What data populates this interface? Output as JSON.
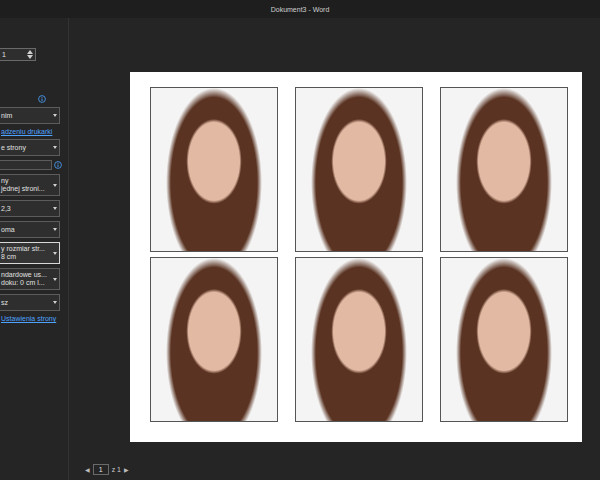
{
  "window": {
    "title": "Dokument3 - Word"
  },
  "left_panel": {
    "items": [
      {
        "kind": "spinner",
        "value": "1"
      },
      {
        "kind": "info"
      },
      {
        "kind": "dropdown",
        "lines": [
          "nim"
        ],
        "focused": false
      },
      {
        "kind": "link",
        "text": "ądzeniu drukarki"
      },
      {
        "kind": "dropdown",
        "lines": [
          "e strony"
        ],
        "focused": false
      },
      {
        "kind": "field",
        "value": ""
      },
      {
        "kind": "dropdown",
        "lines": [
          "ny",
          "jednej stroni..."
        ],
        "focused": false
      },
      {
        "kind": "dropdown",
        "lines": [
          "2,3"
        ],
        "focused": false
      },
      {
        "kind": "dropdown",
        "lines": [
          "oma"
        ],
        "focused": false
      },
      {
        "kind": "dropdown",
        "lines": [
          "y rozmiar str...",
          "8 cm"
        ],
        "focused": true
      },
      {
        "kind": "dropdown",
        "lines": [
          "ndardowe us...",
          "doku: 0 cm l..."
        ],
        "focused": false
      },
      {
        "kind": "dropdown",
        "lines": [
          "sz"
        ],
        "focused": false
      },
      {
        "kind": "link",
        "text": "Ustawienia strony"
      }
    ]
  },
  "preview": {
    "photos": [
      {
        "kind": "photo"
      },
      {
        "kind": "photo"
      },
      {
        "kind": "photo"
      },
      {
        "kind": "photo"
      },
      {
        "kind": "photo"
      },
      {
        "kind": "photo"
      }
    ]
  },
  "pager": {
    "prev": "◀",
    "page": "1",
    "of": "z 1",
    "next": "▶"
  }
}
